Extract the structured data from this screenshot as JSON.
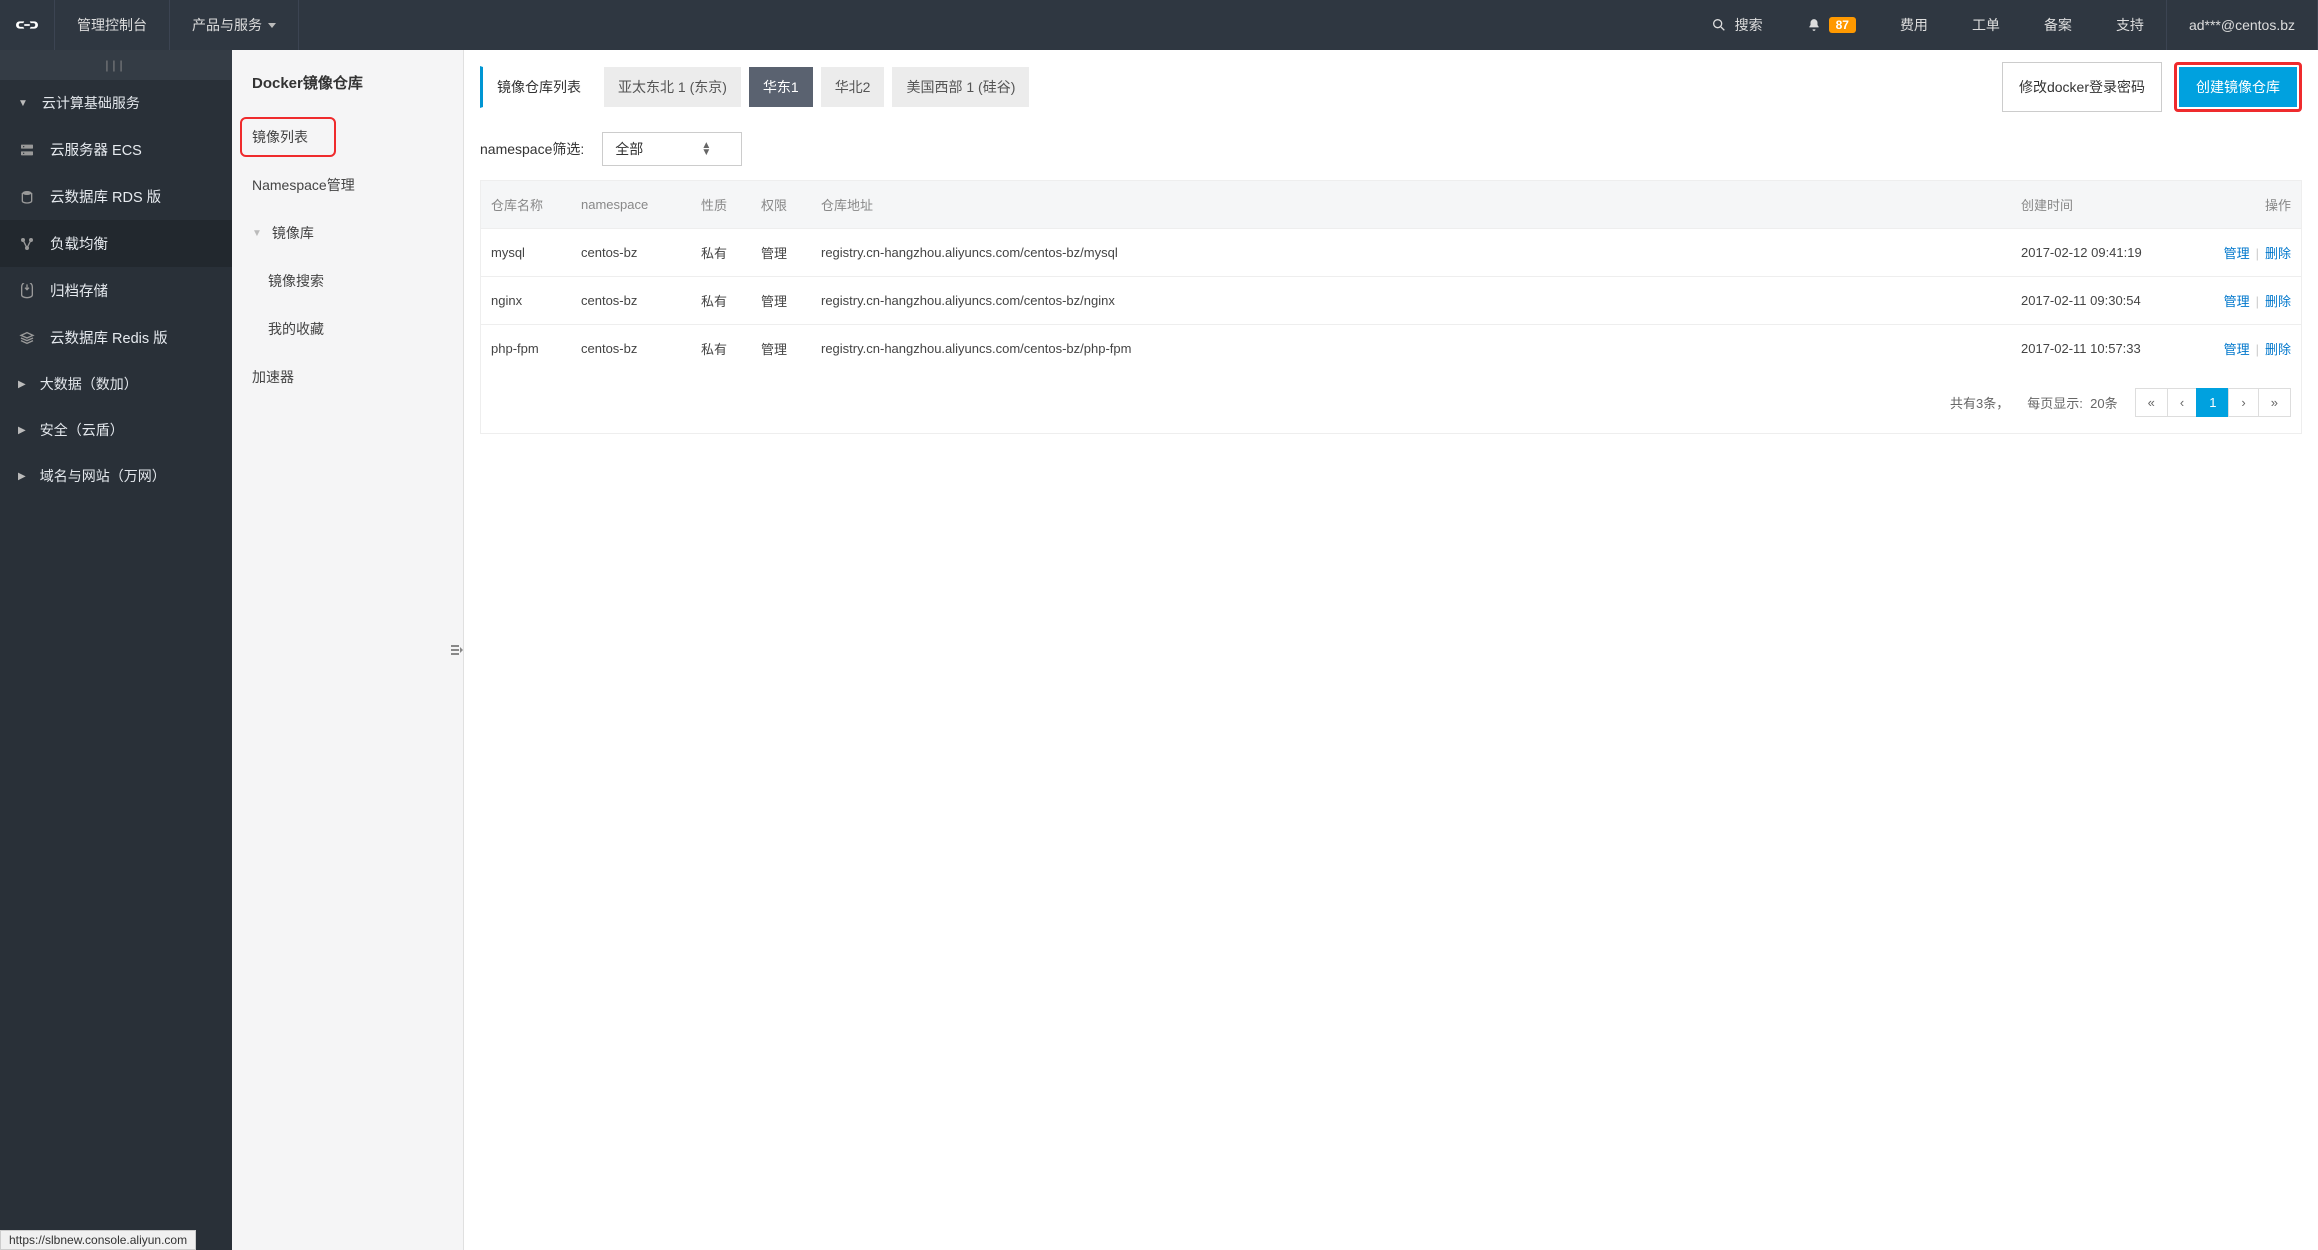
{
  "header": {
    "console": "管理控制台",
    "products": "产品与服务",
    "search": "搜索",
    "notif_count": "87",
    "links": [
      "费用",
      "工单",
      "备案",
      "支持"
    ],
    "user": "ad***@centos.bz"
  },
  "nav1": {
    "category": "云计算基础服务",
    "items": [
      {
        "label": "云服务器 ECS",
        "icon": "server"
      },
      {
        "label": "云数据库 RDS 版",
        "icon": "db"
      },
      {
        "label": "负载均衡",
        "icon": "lb"
      },
      {
        "label": "归档存储",
        "icon": "archive"
      },
      {
        "label": "云数据库 Redis 版",
        "icon": "redis"
      }
    ],
    "subcats": [
      "大数据（数加）",
      "安全（云盾）",
      "域名与网站（万网）"
    ],
    "active_index": 2
  },
  "nav2": {
    "title": "Docker镜像仓库",
    "items": [
      {
        "label": "镜像列表",
        "active": true
      },
      {
        "label": "Namespace管理"
      },
      {
        "label": "镜像库",
        "chevron": true
      },
      {
        "label": "镜像搜索",
        "sub": true
      },
      {
        "label": "我的收藏",
        "sub": true
      },
      {
        "label": "加速器"
      }
    ]
  },
  "main": {
    "tab_primary": "镜像仓库列表",
    "regions": [
      {
        "label": "亚太东北 1 (东京)"
      },
      {
        "label": "华东1",
        "active": true
      },
      {
        "label": "华北2"
      },
      {
        "label": "美国西部 1 (硅谷)"
      }
    ],
    "btn_change_pwd": "修改docker登录密码",
    "btn_create": "创建镜像仓库",
    "filter_label": "namespace筛选:",
    "filter_value": "全部",
    "columns": [
      "仓库名称",
      "namespace",
      "性质",
      "权限",
      "仓库地址",
      "创建时间",
      "操作"
    ],
    "rows": [
      {
        "name": "mysql",
        "ns": "centos-bz",
        "nature": "私有",
        "perm": "管理",
        "addr": "registry.cn-hangzhou.aliyuncs.com/centos-bz/mysql",
        "time": "2017-02-12 09:41:19"
      },
      {
        "name": "nginx",
        "ns": "centos-bz",
        "nature": "私有",
        "perm": "管理",
        "addr": "registry.cn-hangzhou.aliyuncs.com/centos-bz/nginx",
        "time": "2017-02-11 09:30:54"
      },
      {
        "name": "php-fpm",
        "ns": "centos-bz",
        "nature": "私有",
        "perm": "管理",
        "addr": "registry.cn-hangzhou.aliyuncs.com/centos-bz/php-fpm",
        "time": "2017-02-11 10:57:33"
      }
    ],
    "op_manage": "管理",
    "op_delete": "删除",
    "pager": {
      "total": "共有3条，",
      "per_page_label": "每页显示:",
      "per_page": "20条",
      "current": "1"
    }
  },
  "statusbar": "https://slbnew.console.aliyun.com"
}
